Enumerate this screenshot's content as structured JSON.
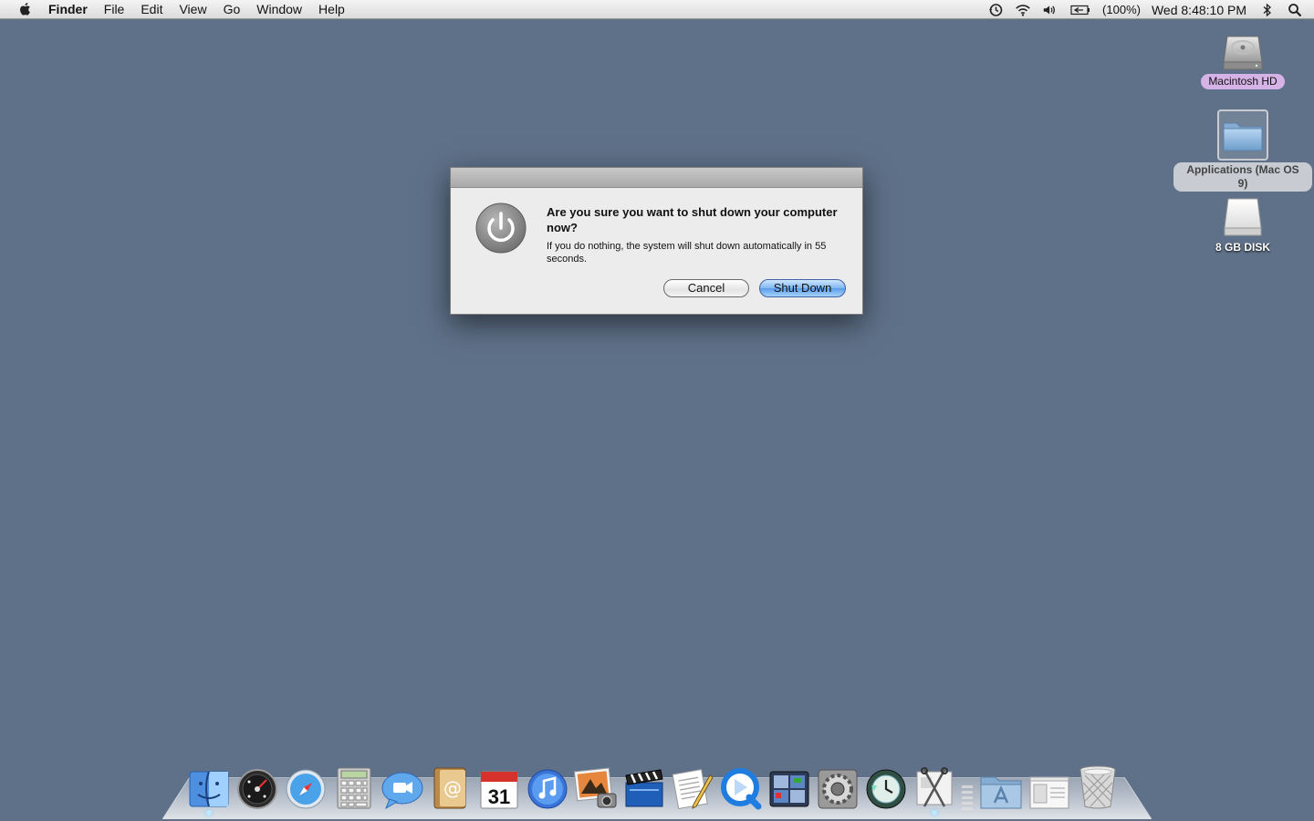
{
  "menubar": {
    "items": [
      "Finder",
      "File",
      "Edit",
      "View",
      "Go",
      "Window",
      "Help"
    ],
    "battery": "(100%)",
    "clock": "Wed 8:48:10 PM"
  },
  "desktop": {
    "icons": [
      {
        "label": "Macintosh HD",
        "icon": "hard-drive-icon"
      },
      {
        "label": "Applications (Mac OS 9)",
        "icon": "folder-icon"
      },
      {
        "label": "8 GB DISK",
        "icon": "external-disk-icon"
      }
    ]
  },
  "dialog": {
    "title": "Are you sure you want to shut down your computer now?",
    "message": "If you do nothing, the system will shut down automatically in 55 seconds.",
    "cancel_label": "Cancel",
    "confirm_label": "Shut Down"
  },
  "dock": {
    "items": [
      {
        "name": "finder",
        "running": true
      },
      {
        "name": "dashboard",
        "running": false
      },
      {
        "name": "safari",
        "running": false
      },
      {
        "name": "calculator",
        "running": false
      },
      {
        "name": "ichat",
        "running": false
      },
      {
        "name": "address-book",
        "running": false
      },
      {
        "name": "ical",
        "running": false
      },
      {
        "name": "itunes",
        "running": false
      },
      {
        "name": "iphoto",
        "running": false
      },
      {
        "name": "imovie",
        "running": false
      },
      {
        "name": "textedit",
        "running": false
      },
      {
        "name": "quicktime",
        "running": false
      },
      {
        "name": "spaces",
        "running": false
      },
      {
        "name": "system-preferences",
        "running": false
      },
      {
        "name": "time-machine",
        "running": false
      },
      {
        "name": "grab",
        "running": true
      }
    ],
    "stacks": [
      {
        "name": "applications-stack"
      },
      {
        "name": "documents-stack"
      },
      {
        "name": "trash"
      }
    ]
  },
  "colors": {
    "desktop": "#5f7189",
    "primary_button": "#5a9de8",
    "selection_purple": "#d6b3e6"
  }
}
